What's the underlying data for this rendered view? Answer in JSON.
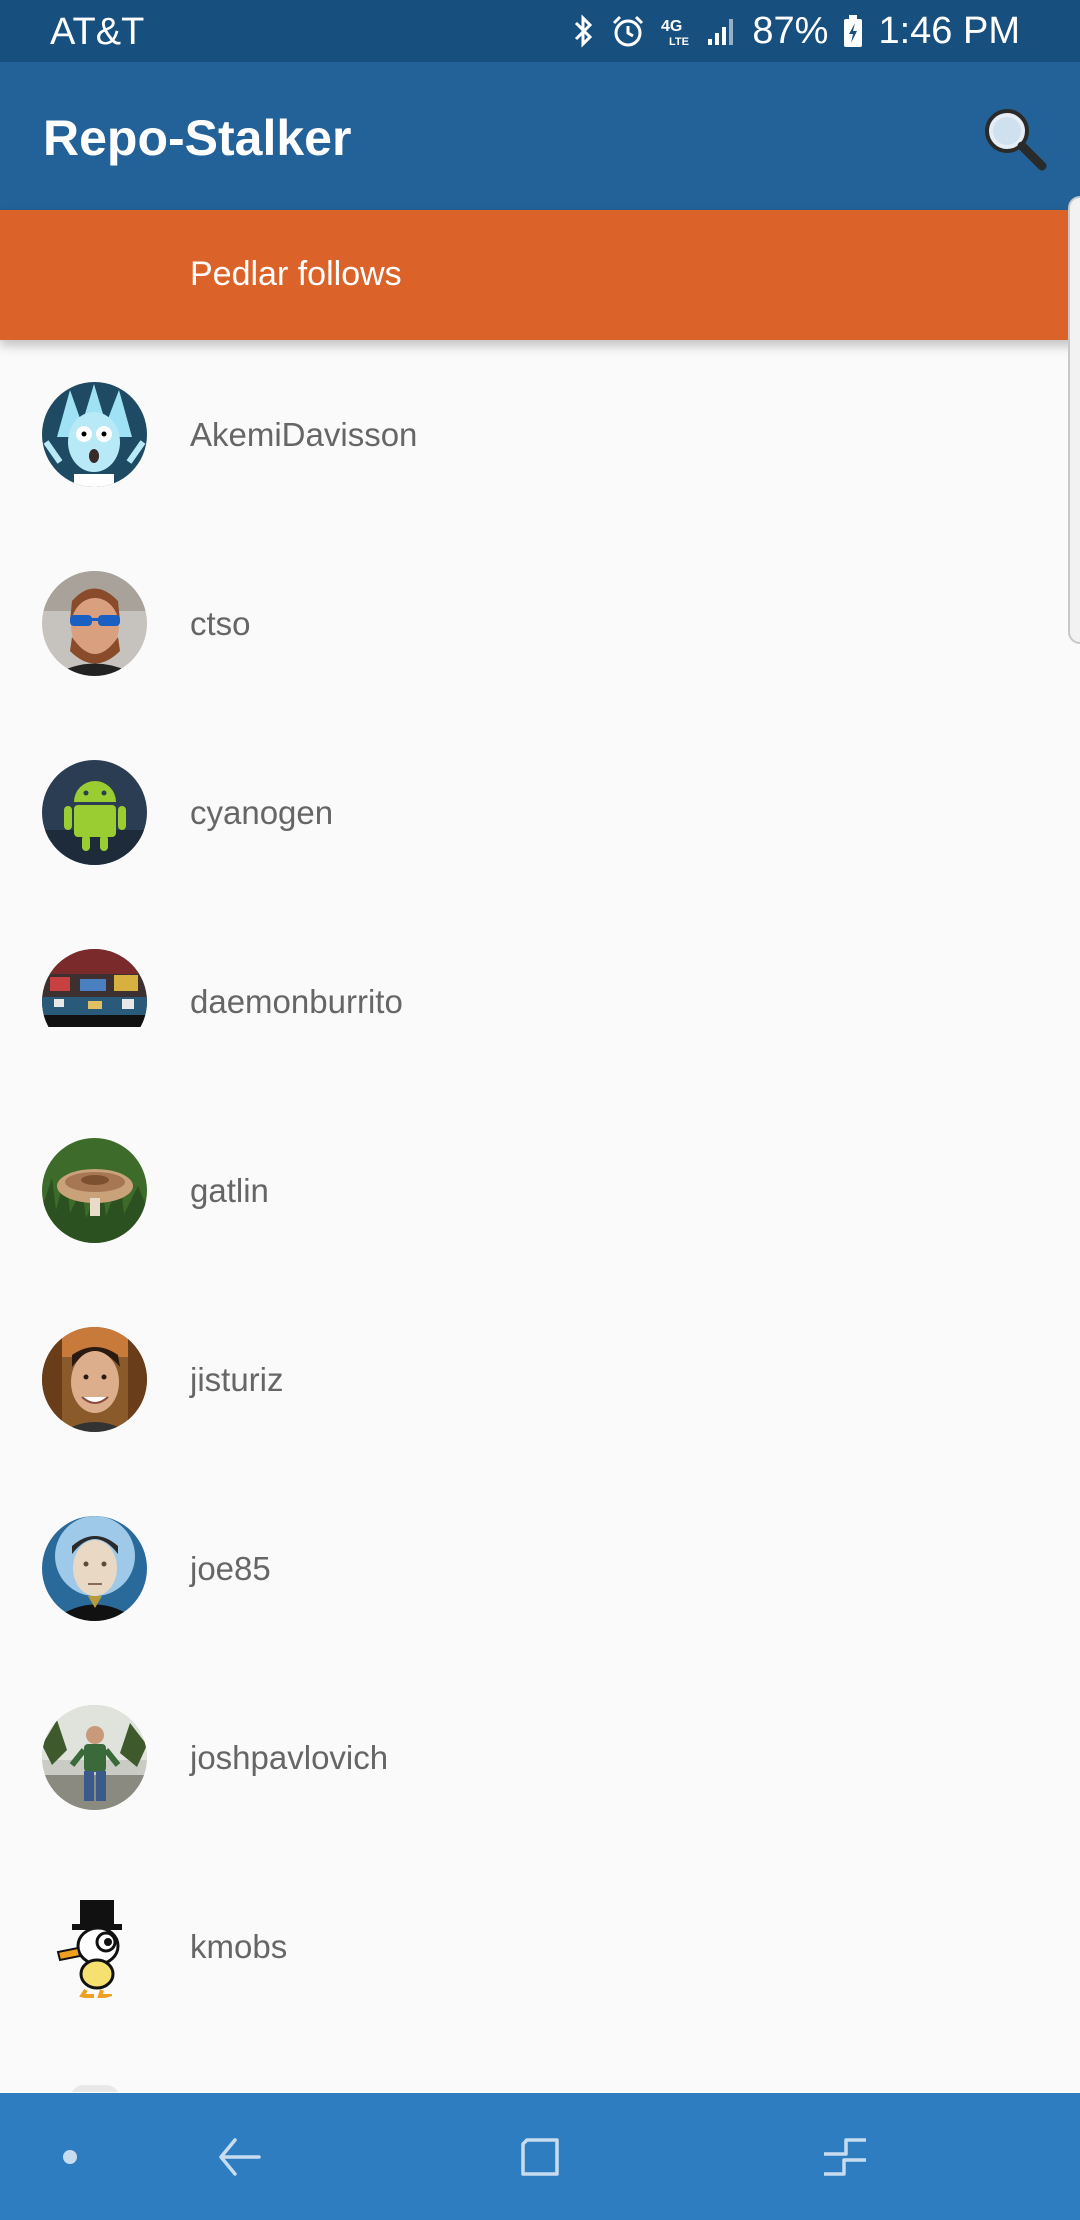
{
  "status_bar": {
    "carrier": "AT&T",
    "network": "4G LTE",
    "battery": "87%",
    "time": "1:46 PM",
    "icons": [
      "bluetooth-icon",
      "alarm-icon",
      "lte-icon",
      "signal-icon",
      "battery-charging-icon"
    ]
  },
  "app_bar": {
    "title": "Repo-Stalker",
    "search_icon": "search-icon"
  },
  "header": {
    "text": "Pedlar follows"
  },
  "following": [
    {
      "username": "AkemiDavisson",
      "avatar": "cartoon-scientist"
    },
    {
      "username": "ctso",
      "avatar": "man-sunglasses"
    },
    {
      "username": "cyanogen",
      "avatar": "android-robot"
    },
    {
      "username": "daemonburrito",
      "avatar": "room-photo"
    },
    {
      "username": "gatlin",
      "avatar": "mushroom"
    },
    {
      "username": "jisturiz",
      "avatar": "man-smiling"
    },
    {
      "username": "joe85",
      "avatar": "android-character"
    },
    {
      "username": "joshpavlovich",
      "avatar": "man-outdoors"
    },
    {
      "username": "kmobs",
      "avatar": "duck-top-hat"
    }
  ],
  "nav_bar": {
    "buttons": [
      "dot-icon",
      "back-icon",
      "home-icon",
      "recents-icon"
    ]
  },
  "colors": {
    "status_bar": "#174f7f",
    "app_bar": "#236298",
    "header": "#db6329",
    "nav_bar": "#2e7dc1",
    "background": "#fafafa"
  }
}
